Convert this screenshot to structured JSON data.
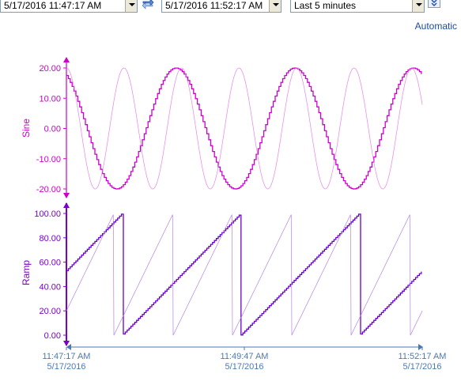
{
  "toolbar": {
    "start_time": "5/17/2016 11:47:17 AM",
    "end_time": "5/17/2016 11:52:17 AM",
    "range": "Last 5 minutes",
    "scale_mode": "Automatic"
  },
  "chart_data": [
    {
      "type": "line",
      "ylabel": "Sine",
      "ylim": [
        -20,
        20
      ],
      "yticks": [
        "20.00",
        "10.00",
        "0.00",
        "-10.00",
        "-20.00"
      ],
      "color": "#cc00cc",
      "series": [
        {
          "amplitude": 20,
          "period_s": 100,
          "color": "#cc00cc",
          "style": "bold-step"
        },
        {
          "amplitude": 20,
          "period_s": 48.5,
          "color": "#e57fe5",
          "style": "light"
        }
      ]
    },
    {
      "type": "line",
      "ylabel": "Ramp",
      "ylim": [
        0,
        100
      ],
      "yticks": [
        "100.00",
        "80.00",
        "60.00",
        "40.00",
        "20.00",
        "0.00"
      ],
      "color": "#7a00cc",
      "series": [
        {
          "amplitude": 100,
          "period_s": 100,
          "offset": 53,
          "color": "#6a00cc",
          "style": "bold-step"
        },
        {
          "amplitude": 100,
          "period_s": 50,
          "offset": 20,
          "color": "#b07fe5",
          "style": "light"
        }
      ]
    }
  ],
  "xaxis": {
    "ticks": [
      {
        "time": "11:47:17 AM",
        "date": "5/17/2016"
      },
      {
        "time": "11:49:47 AM",
        "date": "5/17/2016"
      },
      {
        "time": "11:52:17 AM",
        "date": "5/17/2016"
      }
    ],
    "color": "#4a7ab5"
  }
}
